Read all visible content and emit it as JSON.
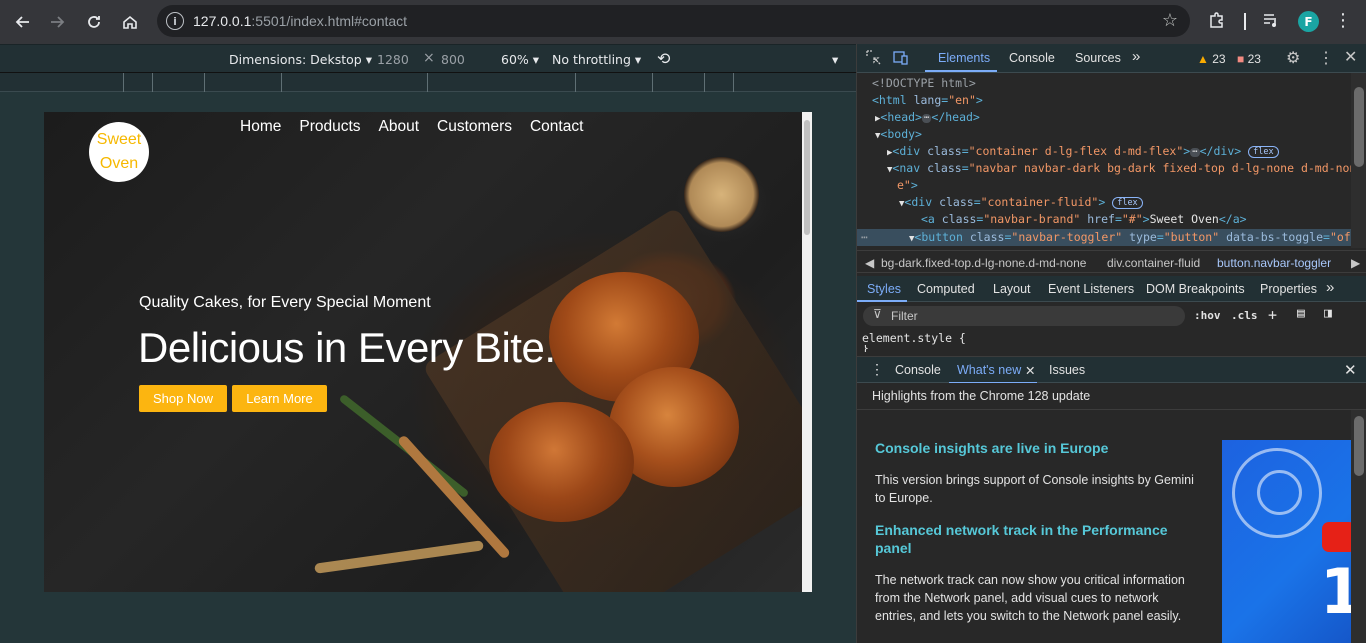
{
  "browser": {
    "url_host": "127.0.0.1",
    "url_rest": ":5501/index.html#contact",
    "avatar_letter": "F"
  },
  "device_toolbar": {
    "dimensions_label": "Dimensions: Dekstop",
    "width": "1280",
    "times": "×",
    "height": "800",
    "zoom": "60%",
    "throttling": "No throttling"
  },
  "site": {
    "logo_line1": "Sweet",
    "logo_line2": "Oven",
    "nav": [
      "Home",
      "Products",
      "About",
      "Customers",
      "Contact"
    ],
    "tagline": "Quality Cakes, for Every Special Moment",
    "headline": "Delicious in Every Bite.",
    "btn_shop": "Shop Now",
    "btn_learn": "Learn More",
    "accent": "#fcb510"
  },
  "devtools": {
    "tabs": [
      "Elements",
      "Console",
      "Sources"
    ],
    "more_tabs": "»",
    "warnings": "23",
    "errors": "23",
    "code": {
      "doctype": "<!DOCTYPE html>",
      "html_open": "<html",
      "html_attr": "lang",
      "html_val": "\"en\"",
      "head": "<head>",
      "head_close": "</head>",
      "body": "<body>",
      "div": "<div",
      "div_class_attr": "class",
      "div_class_val": "\"container d-lg-flex d-md-flex\"",
      "div_close": "</div>",
      "nav": "<nav",
      "nav_class_val": "\"navbar navbar-dark bg-dark fixed-top d-lg-none d-md-non",
      "nav_class_val2": "e\"",
      "inner_div_val": "\"container-fluid\"",
      "a": "<a",
      "a_class_val": "\"navbar-brand\"",
      "a_href_attr": "href",
      "a_href_val": "\"#\"",
      "a_text": "Sweet Oven",
      "a_close": "</a>",
      "button": "<button",
      "button_class_val": "\"navbar-toggler\"",
      "button_type_attr": "type",
      "button_type_val": "\"button\"",
      "button_toggle_attr": "data-bs-toggle",
      "button_toggle_val": "\"offc",
      "pill": "flex"
    },
    "breadcrumbs": [
      "bg-dark.fixed-top.d-lg-none.d-md-none",
      "div.container-fluid",
      "button.navbar-toggler"
    ],
    "subtabs": [
      "Styles",
      "Computed",
      "Layout",
      "Event Listeners",
      "DOM Breakpoints",
      "Properties"
    ],
    "filter_placeholder": "Filter",
    "hov": ":hov",
    "cls": ".cls",
    "element_style": "element.style {",
    "element_style_close": "}",
    "drawer_tabs": [
      "Console",
      "What's new",
      "Issues"
    ],
    "whats_new_header": "Highlights from the Chrome 128 update",
    "whats_new": [
      {
        "h": "Console insights are live in Europe",
        "p": "This version brings support of Console insights by Gemini to Europe."
      },
      {
        "h": "Enhanced network track in the Performance panel",
        "p": "The network track can now show you critical information from the Network panel, add visual cues to network entries, and lets you switch to the Network panel easily."
      }
    ]
  }
}
